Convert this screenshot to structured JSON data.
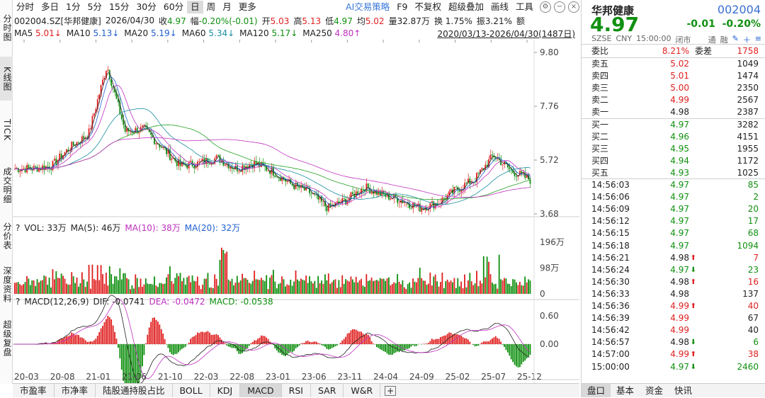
{
  "left_tabs": [
    "分时图",
    "K线图",
    "TICK",
    "成交明细",
    "分价表",
    "深度资料",
    "超级复盘"
  ],
  "toolbar": {
    "items": [
      "分时",
      "多日",
      "1分",
      "5分",
      "15分",
      "30分",
      "60分",
      "日",
      "周",
      "月",
      "更多"
    ],
    "active": "日",
    "right_items": [
      "AI交易策略",
      "F9",
      "不复权",
      "超级叠加",
      "画线",
      "工具"
    ],
    "icons": [
      "settings-icon",
      "minimize-icon",
      "close-icon"
    ]
  },
  "info": {
    "code_name": "002004.SZ[华邦健康]",
    "date": "2026/04/30",
    "close_label": "收",
    "close": "4.97",
    "change_label": "幅",
    "change": "-0.20%(-0.01)",
    "open_label": "开",
    "open": "5.03",
    "high_label": "高",
    "high": "5.13",
    "low_label": "低",
    "low": "4.97",
    "avg_label": "均",
    "avg": "5.02",
    "vol_label": "量",
    "vol": "32.87万",
    "turnover_label": "换",
    "turnover": "1.75%",
    "amp_label": "振",
    "amp": "3.21%",
    "amt_label": "额"
  },
  "ma": {
    "ma5_label": "MA5",
    "ma5": "5.01",
    "ma10_label": "MA10",
    "ma10": "5.13",
    "ma20_label": "MA20",
    "ma20": "5.19",
    "ma60_label": "MA60",
    "ma60": "5.34",
    "ma120_label": "MA120",
    "ma120": "5.17",
    "ma250_label": "MA250",
    "ma250": "4.80",
    "range": "2020/03/13-2026/04/30(1487日)"
  },
  "price_axis": [
    "9.80",
    "7.76",
    "5.72",
    "3.68"
  ],
  "volume": {
    "legend_q": "?",
    "vol_label": "VOL:",
    "vol": "33万",
    "ma5_label": "MA(5):",
    "ma5": "46万",
    "ma10_label": "MA(10):",
    "ma10": "38万",
    "ma20_label": "MA(20):",
    "ma20": "32万",
    "axis": [
      "196万",
      "98万",
      "0"
    ]
  },
  "macd": {
    "legend_q": "?",
    "label": "MACD(12,26,9)",
    "dif_label": "DIF:",
    "dif": "-0.0741",
    "dea_label": "DEA:",
    "dea": "-0.0472",
    "macd_label": "MACD:",
    "macd": "-0.0538",
    "axis": [
      "0.60",
      "0.00"
    ]
  },
  "x_axis": [
    "20-03",
    "20-08",
    "21-01",
    "21-06",
    "21-10",
    "22-03",
    "22-08",
    "23-01",
    "23-06",
    "23-11",
    "24-04",
    "24-09",
    "25-02",
    "25-07",
    "25-12"
  ],
  "bottom_tabs": [
    "市盈率",
    "市净率",
    "陆股通持股占比",
    "BOLL",
    "KDJ",
    "MACD",
    "RSI",
    "SAR",
    "W&R"
  ],
  "bottom_active": "MACD",
  "quote": {
    "name": "华邦健康",
    "code": "002004",
    "price": "4.97",
    "change": "-0.01",
    "change_pct": "-0.20%",
    "sub": [
      "SZSE",
      "CNY",
      "15:00:00",
      "闭市",
      "通",
      "融"
    ],
    "webi_label": "委比",
    "webi": "8.21%",
    "weicha_label": "委差",
    "weicha": "1758",
    "asks": [
      {
        "label": "卖五",
        "price": "5.02",
        "vol": "1049"
      },
      {
        "label": "卖四",
        "price": "5.01",
        "vol": "1474"
      },
      {
        "label": "卖三",
        "price": "5.00",
        "vol": "2350"
      },
      {
        "label": "卖二",
        "price": "4.99",
        "vol": "2567"
      },
      {
        "label": "卖一",
        "price": "4.98",
        "vol": "2387"
      }
    ],
    "bids": [
      {
        "label": "买一",
        "price": "4.97",
        "vol": "3282"
      },
      {
        "label": "买二",
        "price": "4.96",
        "vol": "4151"
      },
      {
        "label": "买三",
        "price": "4.95",
        "vol": "1955"
      },
      {
        "label": "买四",
        "price": "4.94",
        "vol": "1172"
      },
      {
        "label": "买五",
        "price": "4.93",
        "vol": "1025"
      }
    ],
    "ticks": [
      {
        "time": "14:56:03",
        "price": "4.97",
        "vol": "85",
        "dir": ""
      },
      {
        "time": "14:56:06",
        "price": "4.97",
        "vol": "2",
        "dir": ""
      },
      {
        "time": "14:56:09",
        "price": "4.97",
        "vol": "20",
        "dir": ""
      },
      {
        "time": "14:56:12",
        "price": "4.97",
        "vol": "17",
        "dir": ""
      },
      {
        "time": "14:56:15",
        "price": "4.97",
        "vol": "68",
        "dir": ""
      },
      {
        "time": "14:56:18",
        "price": "4.97",
        "vol": "1094",
        "dir": ""
      },
      {
        "time": "14:56:21",
        "price": "4.98",
        "vol": "7",
        "dir": "up"
      },
      {
        "time": "14:56:24",
        "price": "4.97",
        "vol": "23",
        "dir": "down"
      },
      {
        "time": "14:56:30",
        "price": "4.98",
        "vol": "16",
        "dir": "up"
      },
      {
        "time": "14:56:33",
        "price": "4.98",
        "vol": "137",
        "dir": ""
      },
      {
        "time": "14:56:36",
        "price": "4.99",
        "vol": "40",
        "dir": "up"
      },
      {
        "time": "14:56:39",
        "price": "4.99",
        "vol": "67",
        "dir": ""
      },
      {
        "time": "14:56:42",
        "price": "4.99",
        "vol": "40",
        "dir": ""
      },
      {
        "time": "14:56:57",
        "price": "4.98",
        "vol": "6",
        "dir": "down"
      },
      {
        "time": "14:57:00",
        "price": "4.99",
        "vol": "38",
        "dir": "up"
      },
      {
        "time": "15:00:00",
        "price": "4.97",
        "vol": "2460",
        "dir": "down"
      }
    ]
  },
  "right_tabs": [
    "盘口",
    "基本",
    "资金",
    "快讯"
  ],
  "right_active": "盘口",
  "colors": {
    "up": "#e02020",
    "down": "#109010",
    "ma5": "#222222",
    "ma10": "#2060d0",
    "ma20": "#c030c0",
    "ma60": "#1a8fa0",
    "ma120": "#22a022",
    "ma250": "#c030c0"
  },
  "chart_data": {
    "type": "candlestick",
    "price_ylim": [
      3.68,
      9.8
    ],
    "close_series_approx": {
      "x": [
        "20-03",
        "20-08",
        "21-01",
        "21-03",
        "21-06",
        "21-07",
        "21-08",
        "21-10",
        "22-01",
        "22-03",
        "22-06",
        "22-08",
        "23-01",
        "23-04",
        "23-06",
        "23-11",
        "24-01",
        "24-02",
        "24-04",
        "24-06",
        "24-09",
        "25-01",
        "25-02",
        "25-05",
        "25-07",
        "25-09",
        "25-10",
        "25-12",
        "26-04"
      ],
      "values": [
        5.4,
        5.4,
        5.5,
        6.2,
        6.7,
        9.3,
        6.8,
        6.9,
        6.2,
        5.5,
        5.6,
        5.8,
        5.4,
        5.6,
        5.3,
        4.8,
        4.5,
        3.9,
        4.2,
        4.7,
        4.4,
        4.2,
        3.9,
        4.1,
        4.6,
        5.0,
        5.9,
        5.3,
        4.97
      ]
    },
    "volume_axis": [
      0,
      98,
      196
    ],
    "macd_axis": [
      0.0,
      0.6
    ]
  }
}
